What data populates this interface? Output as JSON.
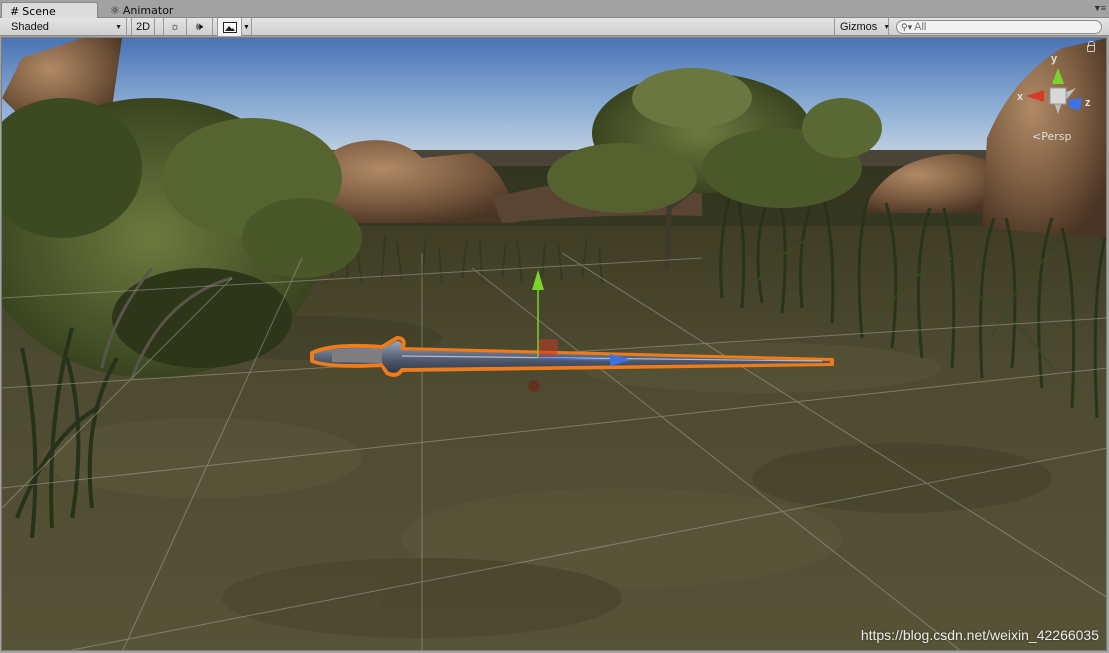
{
  "tabs": [
    {
      "label": "Scene",
      "icon": "grid-icon",
      "active": true
    },
    {
      "label": "Animator",
      "icon": "animator-icon",
      "active": false
    }
  ],
  "toolbar": {
    "draw_mode": "Shaded",
    "mode_2d": "2D",
    "gizmos": "Gizmos",
    "search_placeholder": "All"
  },
  "viewport": {
    "projection": "Persp",
    "axes": {
      "x": "x",
      "y": "y",
      "z": "z"
    },
    "selected_object": "sword",
    "watermark": "https://blog.csdn.net/weixin_42266035"
  },
  "colors": {
    "selection_outline": "#f07b1a",
    "axis_x": "#d63a2a",
    "axis_y": "#7ad32a",
    "axis_z": "#3b72e6",
    "toolbar_bg": "#d7d7d7",
    "sky_top": "#4d77b8"
  }
}
